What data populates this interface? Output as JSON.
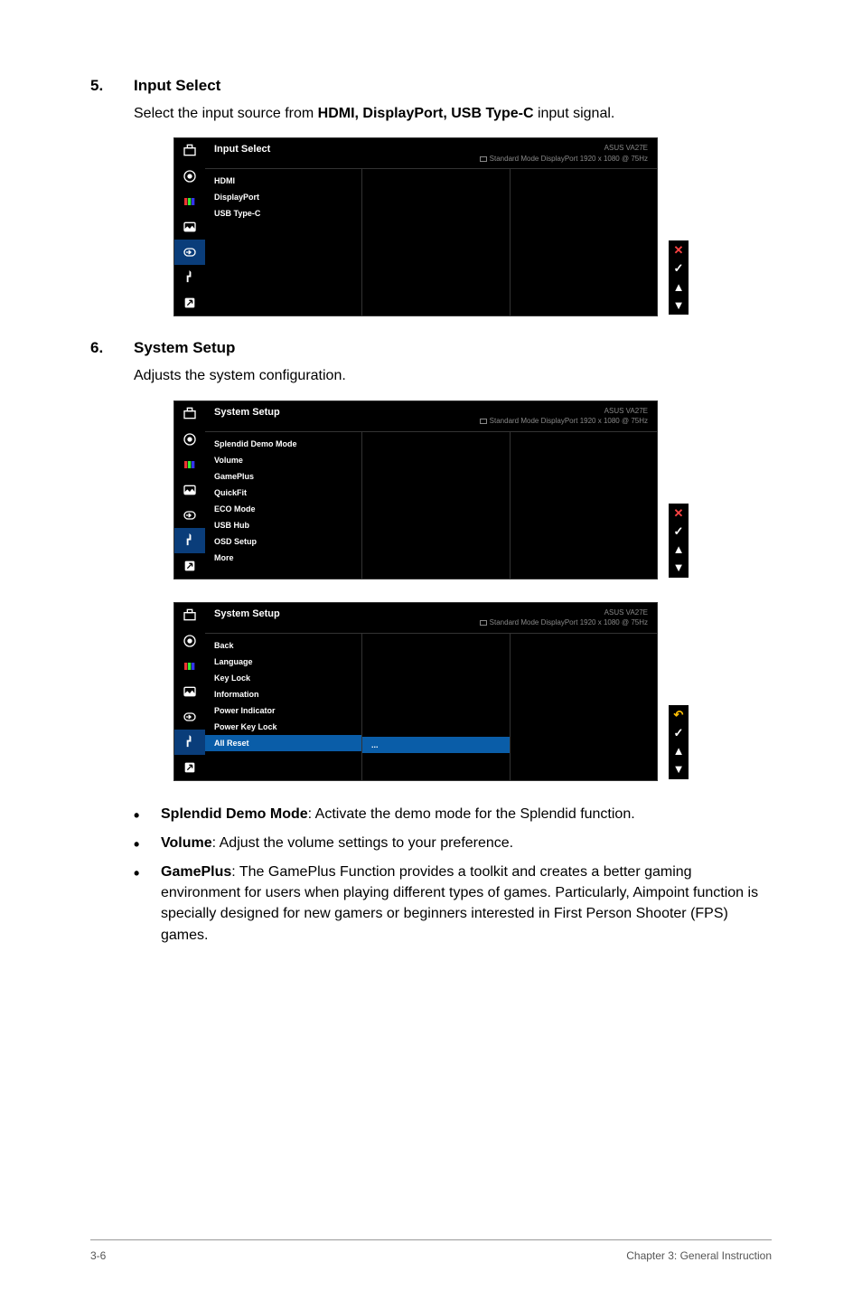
{
  "sections": {
    "s5": {
      "number": "5.",
      "title": "Input Select",
      "body_prefix": "Select the input source from ",
      "body_bold": "HDMI, DisplayPort, USB Type-C",
      "body_suffix": " input signal."
    },
    "s6": {
      "number": "6.",
      "title": "System Setup",
      "body": "Adjusts the system configuration."
    }
  },
  "osd_common": {
    "brand": "ASUS  VA27E",
    "status": "Standard Mode  DisplayPort 1920 x 1080 @ 75Hz"
  },
  "osd1": {
    "title": "Input Select",
    "items": [
      "HDMI",
      "DisplayPort",
      "USB Type-C"
    ]
  },
  "osd2": {
    "title": "System Setup",
    "items": [
      "Splendid Demo Mode",
      "Volume",
      "GamePlus",
      "QuickFit",
      "ECO Mode",
      "USB Hub",
      "OSD Setup",
      "More"
    ]
  },
  "osd3": {
    "title": "System Setup",
    "items": [
      "Back",
      "Language",
      "Key Lock",
      "Information",
      "Power Indicator",
      "Power Key Lock",
      "All Reset"
    ],
    "highlighted_value": "..."
  },
  "legend": {
    "close": "✕",
    "check": "✓",
    "up": "▲",
    "down": "▼",
    "back": "↶"
  },
  "bullets": {
    "b1": {
      "label": "Splendid Demo Mode",
      "text": ": Activate the demo mode for the Splendid function."
    },
    "b2": {
      "label": "Volume",
      "text": ": Adjust the volume settings to your preference."
    },
    "b3": {
      "label": "GamePlus",
      "text": ": The GamePlus Function provides a toolkit and creates a better gaming environment for users when playing different types of games. Particularly, Aimpoint function is specially designed for new gamers or beginners interested in First Person Shooter (FPS) games."
    }
  },
  "footer": {
    "left": "3-6",
    "right": "Chapter 3: General Instruction"
  }
}
